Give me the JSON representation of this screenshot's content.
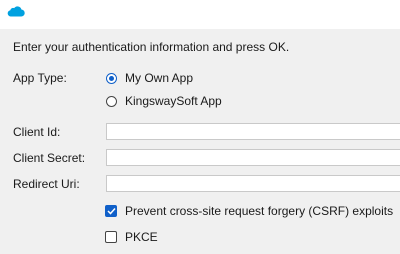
{
  "header": {
    "brand_icon": "salesforce-cloud-icon",
    "brand_color": "#00a1e0"
  },
  "instructions": "Enter your authentication information and press OK.",
  "app_type": {
    "label": "App Type:",
    "options": [
      {
        "label": "My Own App",
        "selected": true
      },
      {
        "label": "KingswaySoft App",
        "selected": false
      }
    ]
  },
  "fields": {
    "client_id": {
      "label": "Client Id:",
      "value": ""
    },
    "client_secret": {
      "label": "Client Secret:",
      "value": ""
    },
    "redirect_uri": {
      "label": "Redirect Uri:",
      "value": ""
    }
  },
  "options": {
    "csrf": {
      "label": "Prevent cross-site request forgery (CSRF) exploits",
      "checked": true
    },
    "pkce": {
      "label": "PKCE",
      "checked": false
    }
  },
  "colors": {
    "accent": "#1060c9",
    "background": "#f0f0f0"
  }
}
